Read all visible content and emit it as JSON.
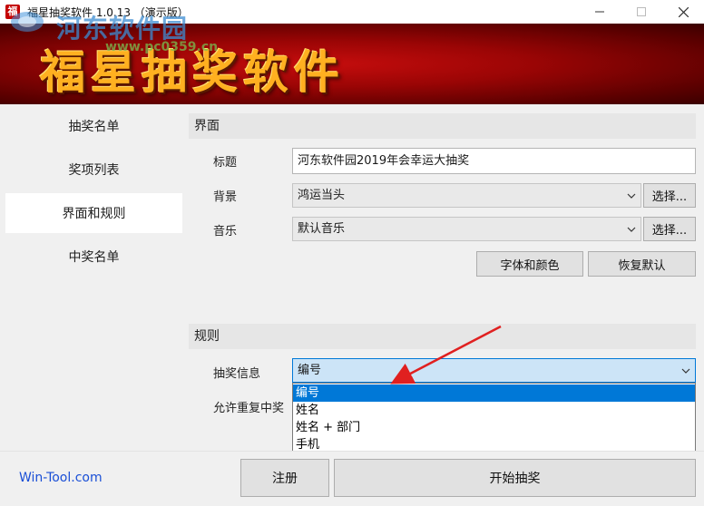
{
  "window": {
    "icon_glyph": "福",
    "title": "福星抽奖软件 1.0.13 （演示版）"
  },
  "banner": {
    "title": "福星抽奖软件",
    "watermark_text": "河东软件园",
    "watermark_url": "www.pc0359.cn"
  },
  "sidebar": {
    "items": [
      {
        "label": "抽奖名单"
      },
      {
        "label": "奖项列表"
      },
      {
        "label": "界面和规则",
        "active": true
      },
      {
        "label": "中奖名单"
      }
    ]
  },
  "interface_section": {
    "header": "界面",
    "title_label": "标题",
    "title_value": "河东软件园2019年会幸运大抽奖",
    "background_label": "背景",
    "background_value": "鸿运当头",
    "background_button": "选择...",
    "music_label": "音乐",
    "music_value": "默认音乐",
    "music_button": "选择...",
    "font_color_button": "字体和颜色",
    "restore_default_button": "恢复默认"
  },
  "rules_section": {
    "header": "规则",
    "info_label": "抽奖信息",
    "info_value": "编号",
    "repeat_label": "允许重复中奖",
    "dropdown_options": [
      "编号",
      "姓名",
      "姓名 + 部门",
      "手机"
    ],
    "dropdown_selected_index": 0
  },
  "footer": {
    "link": "Win-Tool.com",
    "register_button": "注册",
    "start_button": "开始抽奖"
  },
  "colors": {
    "accent": "#0078d7",
    "banner_red": "#9a0505",
    "banner_gold": "#ffb020",
    "annotation_arrow": "#e02020"
  }
}
